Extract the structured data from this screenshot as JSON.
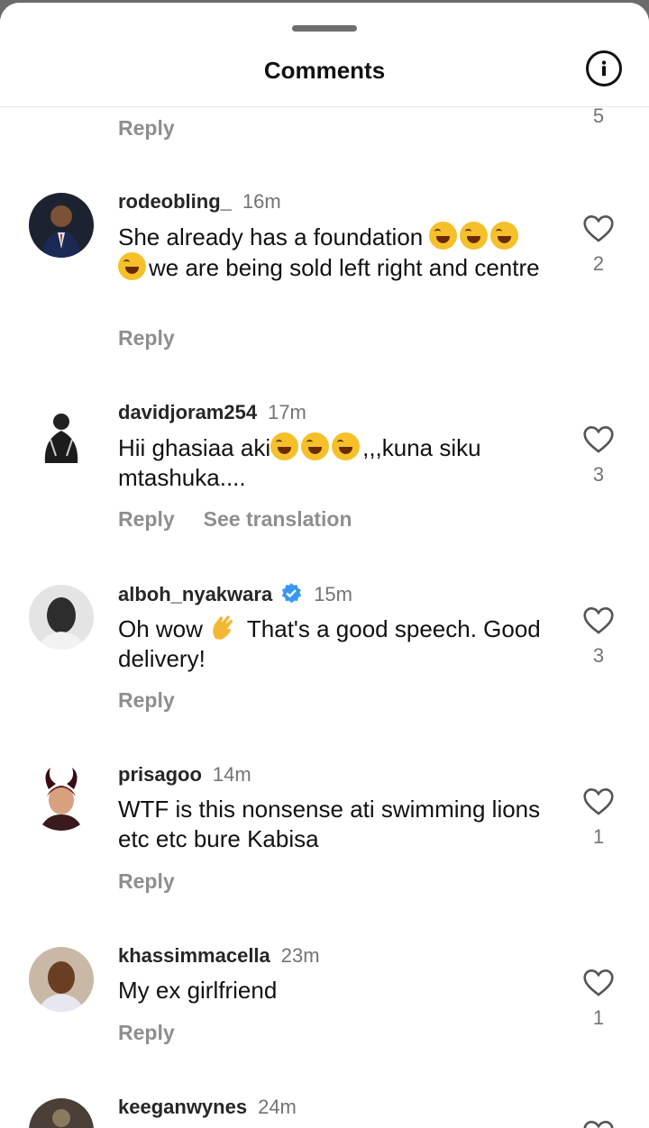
{
  "header": {
    "title": "Comments"
  },
  "partial_top": {
    "reply_label": "Reply",
    "like_count": "5"
  },
  "comments": [
    {
      "username": "rodeobling_",
      "time": "16m",
      "text": "She already has a foundation 😂😂😂😂we are being sold left right and centre",
      "reply_label": "Reply",
      "like_count": "2"
    },
    {
      "username": "davidjoram254",
      "time": "17m",
      "text": "Hii ghasiaa aki😂😂😂,,,kuna siku mtashuka....",
      "reply_label": "Reply",
      "translate_label": "See translation",
      "like_count": "3"
    },
    {
      "username": "alboh_nyakwara",
      "time": "15m",
      "verified": true,
      "text": "Oh wow 👏 That's a good speech. Good delivery!",
      "reply_label": "Reply",
      "like_count": "3"
    },
    {
      "username": "prisagoo",
      "time": "14m",
      "text": "WTF is this nonsense ati swimming lions etc etc bure Kabisa",
      "reply_label": "Reply",
      "like_count": "1"
    },
    {
      "username": "khassimmacella",
      "time": "23m",
      "text": "My ex girlfriend",
      "reply_label": "Reply",
      "like_count": "1"
    },
    {
      "username": "keeganwynes",
      "time": "24m"
    }
  ],
  "colors": {
    "verified_badge": "#3897f0",
    "muted_text": "#8e8e8e",
    "overlay": "#6b6b6b"
  },
  "icons": {
    "info": "info-circle-icon",
    "like": "heart-outline-icon"
  }
}
